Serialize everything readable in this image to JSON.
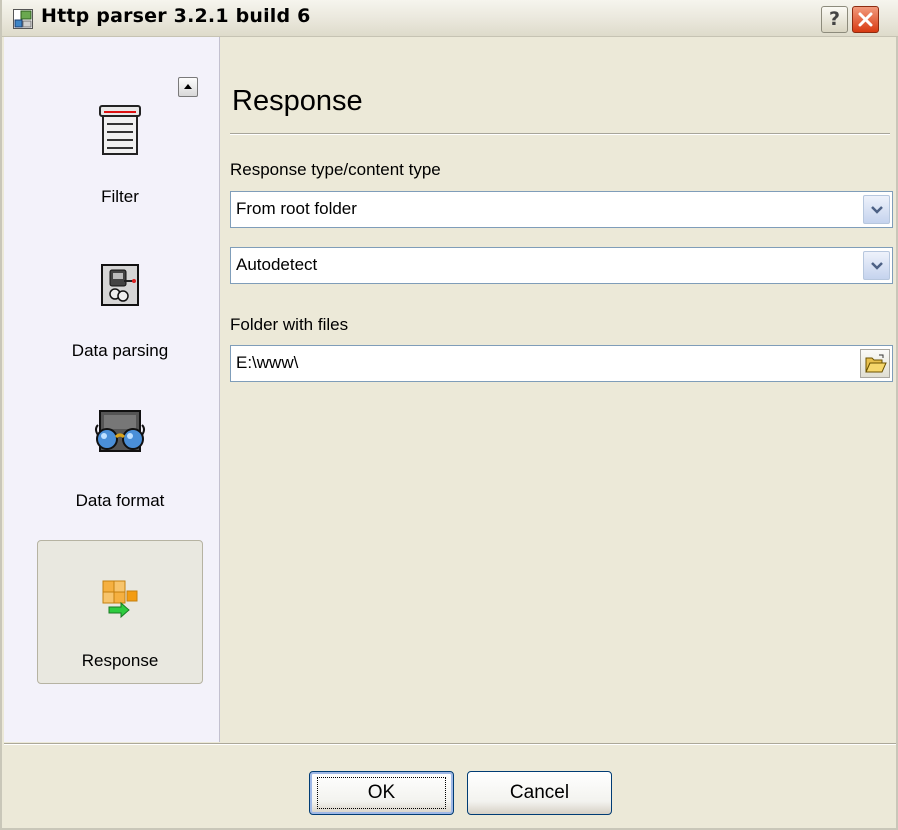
{
  "window": {
    "title": "Http parser 3.2.1 build 6"
  },
  "titlebar": {
    "help_label": "?"
  },
  "sidebar": {
    "items": [
      {
        "label": "Filter",
        "icon": "filter-icon",
        "selected": false
      },
      {
        "label": "Data parsing",
        "icon": "data-parsing-icon",
        "selected": false
      },
      {
        "label": "Data format",
        "icon": "data-format-icon",
        "selected": false
      },
      {
        "label": "Response",
        "icon": "response-icon",
        "selected": true
      }
    ]
  },
  "main": {
    "heading": "Response",
    "type_label": "Response type/content type",
    "response_type": "From root folder",
    "content_type": "Autodetect",
    "folder_label": "Folder with files",
    "folder_value": "E:\\www\\"
  },
  "buttons": {
    "ok": "OK",
    "cancel": "Cancel"
  },
  "colors": {
    "close": "#d83a12",
    "selected_item": "#e9e8e0",
    "sidebar_bg": "#f3f2fa",
    "field_border": "#7f9db9"
  }
}
